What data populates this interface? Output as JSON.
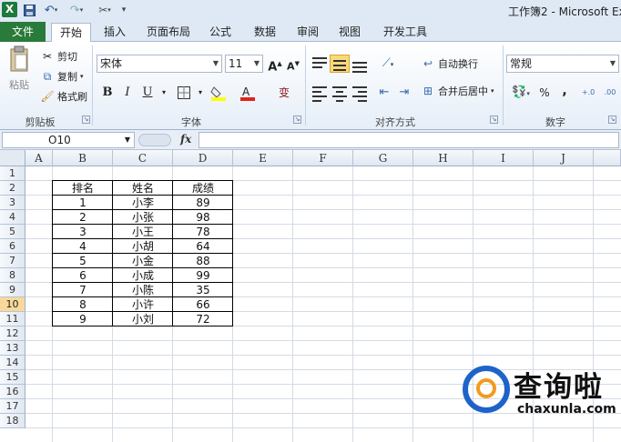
{
  "window": {
    "title": "工作簿2 - Microsoft Exc",
    "app_logo": "X"
  },
  "quick_access": {
    "save_icon": "save-icon",
    "undo_icon": "undo-icon",
    "redo_icon": "redo-icon",
    "customize_icon": "customize-icon"
  },
  "tabs": {
    "file": "文件",
    "home": "开始",
    "insert": "插入",
    "page_layout": "页面布局",
    "formulas": "公式",
    "data": "数据",
    "review": "审阅",
    "view": "视图",
    "developer": "开发工具"
  },
  "clipboard": {
    "paste": "粘贴",
    "cut": "剪切",
    "copy": "复制",
    "format_painter": "格式刷",
    "label": "剪贴板"
  },
  "font": {
    "name": "宋体",
    "size": "11",
    "grow": "A",
    "shrink": "A",
    "bold": "B",
    "italic": "I",
    "underline": "U",
    "phonetic": "变",
    "label": "字体"
  },
  "alignment": {
    "wrap": "自动换行",
    "merge": "合并后居中",
    "label": "对齐方式"
  },
  "number": {
    "format": "常规",
    "percent": "%",
    "comma": ",",
    "label": "数字"
  },
  "formula_bar": {
    "name_box": "O10",
    "fx": "fx",
    "formula": ""
  },
  "columns": [
    "A",
    "B",
    "C",
    "D",
    "E",
    "F",
    "G",
    "H",
    "I",
    "J"
  ],
  "rows": [
    "1",
    "2",
    "3",
    "4",
    "5",
    "6",
    "7",
    "8",
    "9",
    "10",
    "11",
    "12",
    "13",
    "14",
    "15",
    "16",
    "17",
    "18"
  ],
  "active_row": "10",
  "table": {
    "headers": [
      "排名",
      "姓名",
      "成绩"
    ],
    "rows": [
      [
        "1",
        "小李",
        "89"
      ],
      [
        "2",
        "小张",
        "98"
      ],
      [
        "3",
        "小王",
        "78"
      ],
      [
        "4",
        "小胡",
        "64"
      ],
      [
        "5",
        "小金",
        "88"
      ],
      [
        "6",
        "小成",
        "99"
      ],
      [
        "7",
        "小陈",
        "35"
      ],
      [
        "8",
        "小许",
        "66"
      ],
      [
        "9",
        "小刘",
        "72"
      ]
    ]
  },
  "watermark": {
    "cn": "查询啦",
    "en": "chaxunla.com"
  },
  "colors": {
    "file_tab": "#2a7a3a",
    "active_row": "#f9d99a",
    "watermark_blue": "#1e63c8",
    "watermark_orange": "#f39a1e"
  }
}
